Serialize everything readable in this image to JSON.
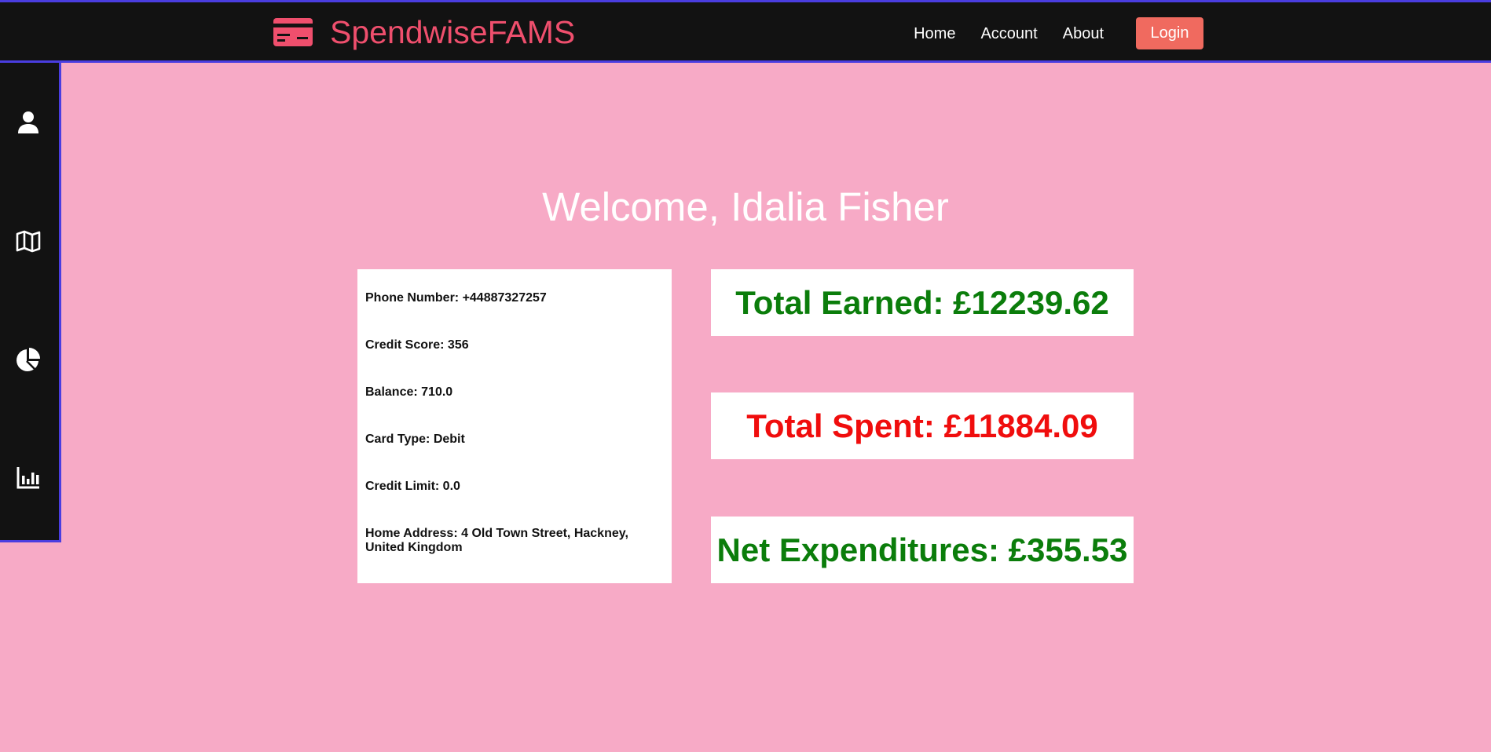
{
  "header": {
    "brand_name": "SpendwiseFAMS",
    "brand_icon": "credit-card-icon",
    "nav": {
      "home": "Home",
      "account": "Account",
      "about": "About"
    },
    "login_label": "Login"
  },
  "sidebar": {
    "icons": [
      "user-icon",
      "map-icon",
      "pie-chart-icon",
      "bar-chart-icon"
    ]
  },
  "main": {
    "welcome": "Welcome, Idalia Fisher",
    "info": {
      "phone": "Phone Number: +44887327257",
      "credit_score": "Credit Score: 356",
      "balance": "Balance: 710.0",
      "card_type": "Card Type: Debit",
      "credit_limit": "Credit Limit: 0.0",
      "home_address": "Home Address: 4 Old Town Street, Hackney, United Kingdom"
    },
    "stats": {
      "total_earned": "Total Earned: £12239.62",
      "total_spent": "Total Spent: £11884.09",
      "net_expenditures": "Net Expenditures: £355.53"
    }
  },
  "colors": {
    "background": "#f7aac6",
    "bar": "#121212",
    "accent_border": "#4a3de0",
    "brand": "#ef4f6d",
    "login": "#f06a5f",
    "positive": "#0b7d0b",
    "negative": "#f00d0d"
  }
}
